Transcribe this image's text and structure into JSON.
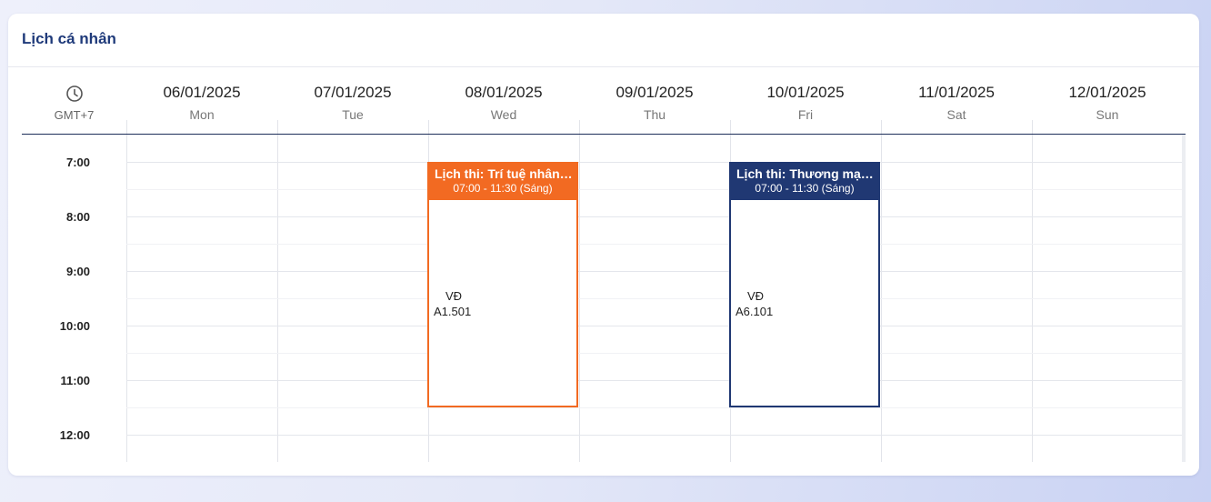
{
  "card": {
    "title": "Lịch cá nhân"
  },
  "timezone": {
    "icon": "clock-icon",
    "label": "GMT+7"
  },
  "days": [
    {
      "date": "06/01/2025",
      "name": "Mon"
    },
    {
      "date": "07/01/2025",
      "name": "Tue"
    },
    {
      "date": "08/01/2025",
      "name": "Wed"
    },
    {
      "date": "09/01/2025",
      "name": "Thu"
    },
    {
      "date": "10/01/2025",
      "name": "Fri"
    },
    {
      "date": "11/01/2025",
      "name": "Sat"
    },
    {
      "date": "12/01/2025",
      "name": "Sun"
    }
  ],
  "hours": [
    "7:00",
    "8:00",
    "9:00",
    "10:00",
    "11:00",
    "12:00"
  ],
  "events": [
    {
      "title": "Lịch thi: Trí tuệ nhân tạo",
      "time": "07:00 - 11:30 (Sáng)",
      "building": "VĐ",
      "room": "A1.501",
      "day": "Wed",
      "color": "#f26a22"
    },
    {
      "title": "Lịch thi: Thương mại điện tử",
      "time": "07:00 - 11:30 (Sáng)",
      "building": "VĐ",
      "room": "A6.101",
      "day": "Fri",
      "color": "#203873"
    }
  ]
}
